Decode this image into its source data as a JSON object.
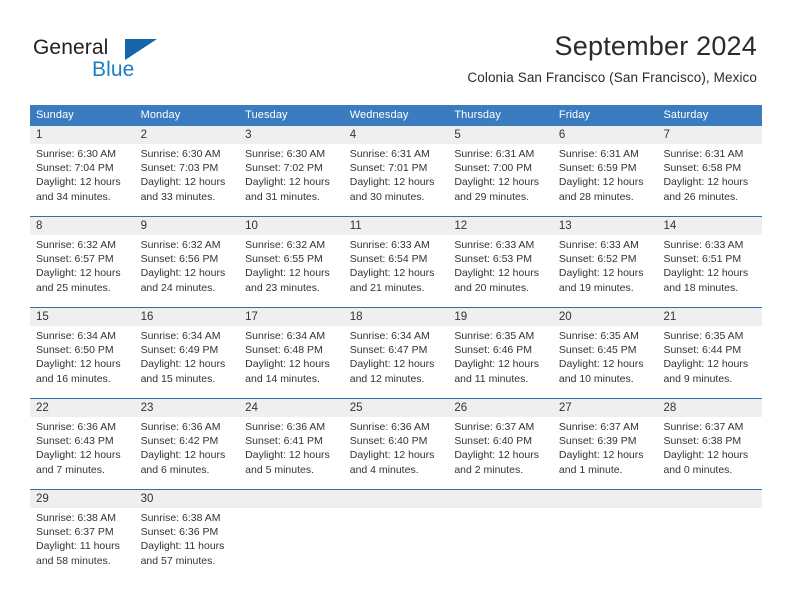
{
  "brand": {
    "name_top": "General",
    "name_bottom": "Blue",
    "triangle_icon": "blue-triangle-logo-mark",
    "color_dark": "#231f20",
    "color_blue": "#1b7dc4"
  },
  "header": {
    "title": "September 2024",
    "subtitle": "Colonia San Francisco (San Francisco), Mexico"
  },
  "theme": {
    "header_blue": "#3a7cbf",
    "week_border_blue": "#2f6fb0",
    "daynum_band": "#efefef"
  },
  "weekdays": [
    "Sunday",
    "Monday",
    "Tuesday",
    "Wednesday",
    "Thursday",
    "Friday",
    "Saturday"
  ],
  "weeks": [
    [
      {
        "day": "1",
        "sunrise": "Sunrise: 6:30 AM",
        "sunset": "Sunset: 7:04 PM",
        "daylight1": "Daylight: 12 hours",
        "daylight2": "and 34 minutes."
      },
      {
        "day": "2",
        "sunrise": "Sunrise: 6:30 AM",
        "sunset": "Sunset: 7:03 PM",
        "daylight1": "Daylight: 12 hours",
        "daylight2": "and 33 minutes."
      },
      {
        "day": "3",
        "sunrise": "Sunrise: 6:30 AM",
        "sunset": "Sunset: 7:02 PM",
        "daylight1": "Daylight: 12 hours",
        "daylight2": "and 31 minutes."
      },
      {
        "day": "4",
        "sunrise": "Sunrise: 6:31 AM",
        "sunset": "Sunset: 7:01 PM",
        "daylight1": "Daylight: 12 hours",
        "daylight2": "and 30 minutes."
      },
      {
        "day": "5",
        "sunrise": "Sunrise: 6:31 AM",
        "sunset": "Sunset: 7:00 PM",
        "daylight1": "Daylight: 12 hours",
        "daylight2": "and 29 minutes."
      },
      {
        "day": "6",
        "sunrise": "Sunrise: 6:31 AM",
        "sunset": "Sunset: 6:59 PM",
        "daylight1": "Daylight: 12 hours",
        "daylight2": "and 28 minutes."
      },
      {
        "day": "7",
        "sunrise": "Sunrise: 6:31 AM",
        "sunset": "Sunset: 6:58 PM",
        "daylight1": "Daylight: 12 hours",
        "daylight2": "and 26 minutes."
      }
    ],
    [
      {
        "day": "8",
        "sunrise": "Sunrise: 6:32 AM",
        "sunset": "Sunset: 6:57 PM",
        "daylight1": "Daylight: 12 hours",
        "daylight2": "and 25 minutes."
      },
      {
        "day": "9",
        "sunrise": "Sunrise: 6:32 AM",
        "sunset": "Sunset: 6:56 PM",
        "daylight1": "Daylight: 12 hours",
        "daylight2": "and 24 minutes."
      },
      {
        "day": "10",
        "sunrise": "Sunrise: 6:32 AM",
        "sunset": "Sunset: 6:55 PM",
        "daylight1": "Daylight: 12 hours",
        "daylight2": "and 23 minutes."
      },
      {
        "day": "11",
        "sunrise": "Sunrise: 6:33 AM",
        "sunset": "Sunset: 6:54 PM",
        "daylight1": "Daylight: 12 hours",
        "daylight2": "and 21 minutes."
      },
      {
        "day": "12",
        "sunrise": "Sunrise: 6:33 AM",
        "sunset": "Sunset: 6:53 PM",
        "daylight1": "Daylight: 12 hours",
        "daylight2": "and 20 minutes."
      },
      {
        "day": "13",
        "sunrise": "Sunrise: 6:33 AM",
        "sunset": "Sunset: 6:52 PM",
        "daylight1": "Daylight: 12 hours",
        "daylight2": "and 19 minutes."
      },
      {
        "day": "14",
        "sunrise": "Sunrise: 6:33 AM",
        "sunset": "Sunset: 6:51 PM",
        "daylight1": "Daylight: 12 hours",
        "daylight2": "and 18 minutes."
      }
    ],
    [
      {
        "day": "15",
        "sunrise": "Sunrise: 6:34 AM",
        "sunset": "Sunset: 6:50 PM",
        "daylight1": "Daylight: 12 hours",
        "daylight2": "and 16 minutes."
      },
      {
        "day": "16",
        "sunrise": "Sunrise: 6:34 AM",
        "sunset": "Sunset: 6:49 PM",
        "daylight1": "Daylight: 12 hours",
        "daylight2": "and 15 minutes."
      },
      {
        "day": "17",
        "sunrise": "Sunrise: 6:34 AM",
        "sunset": "Sunset: 6:48 PM",
        "daylight1": "Daylight: 12 hours",
        "daylight2": "and 14 minutes."
      },
      {
        "day": "18",
        "sunrise": "Sunrise: 6:34 AM",
        "sunset": "Sunset: 6:47 PM",
        "daylight1": "Daylight: 12 hours",
        "daylight2": "and 12 minutes."
      },
      {
        "day": "19",
        "sunrise": "Sunrise: 6:35 AM",
        "sunset": "Sunset: 6:46 PM",
        "daylight1": "Daylight: 12 hours",
        "daylight2": "and 11 minutes."
      },
      {
        "day": "20",
        "sunrise": "Sunrise: 6:35 AM",
        "sunset": "Sunset: 6:45 PM",
        "daylight1": "Daylight: 12 hours",
        "daylight2": "and 10 minutes."
      },
      {
        "day": "21",
        "sunrise": "Sunrise: 6:35 AM",
        "sunset": "Sunset: 6:44 PM",
        "daylight1": "Daylight: 12 hours",
        "daylight2": "and 9 minutes."
      }
    ],
    [
      {
        "day": "22",
        "sunrise": "Sunrise: 6:36 AM",
        "sunset": "Sunset: 6:43 PM",
        "daylight1": "Daylight: 12 hours",
        "daylight2": "and 7 minutes."
      },
      {
        "day": "23",
        "sunrise": "Sunrise: 6:36 AM",
        "sunset": "Sunset: 6:42 PM",
        "daylight1": "Daylight: 12 hours",
        "daylight2": "and 6 minutes."
      },
      {
        "day": "24",
        "sunrise": "Sunrise: 6:36 AM",
        "sunset": "Sunset: 6:41 PM",
        "daylight1": "Daylight: 12 hours",
        "daylight2": "and 5 minutes."
      },
      {
        "day": "25",
        "sunrise": "Sunrise: 6:36 AM",
        "sunset": "Sunset: 6:40 PM",
        "daylight1": "Daylight: 12 hours",
        "daylight2": "and 4 minutes."
      },
      {
        "day": "26",
        "sunrise": "Sunrise: 6:37 AM",
        "sunset": "Sunset: 6:40 PM",
        "daylight1": "Daylight: 12 hours",
        "daylight2": "and 2 minutes."
      },
      {
        "day": "27",
        "sunrise": "Sunrise: 6:37 AM",
        "sunset": "Sunset: 6:39 PM",
        "daylight1": "Daylight: 12 hours",
        "daylight2": "and 1 minute."
      },
      {
        "day": "28",
        "sunrise": "Sunrise: 6:37 AM",
        "sunset": "Sunset: 6:38 PM",
        "daylight1": "Daylight: 12 hours",
        "daylight2": "and 0 minutes."
      }
    ],
    [
      {
        "day": "29",
        "sunrise": "Sunrise: 6:38 AM",
        "sunset": "Sunset: 6:37 PM",
        "daylight1": "Daylight: 11 hours",
        "daylight2": "and 58 minutes."
      },
      {
        "day": "30",
        "sunrise": "Sunrise: 6:38 AM",
        "sunset": "Sunset: 6:36 PM",
        "daylight1": "Daylight: 11 hours",
        "daylight2": "and 57 minutes."
      },
      {
        "day": "",
        "sunrise": "",
        "sunset": "",
        "daylight1": "",
        "daylight2": ""
      },
      {
        "day": "",
        "sunrise": "",
        "sunset": "",
        "daylight1": "",
        "daylight2": ""
      },
      {
        "day": "",
        "sunrise": "",
        "sunset": "",
        "daylight1": "",
        "daylight2": ""
      },
      {
        "day": "",
        "sunrise": "",
        "sunset": "",
        "daylight1": "",
        "daylight2": ""
      },
      {
        "day": "",
        "sunrise": "",
        "sunset": "",
        "daylight1": "",
        "daylight2": ""
      }
    ]
  ]
}
